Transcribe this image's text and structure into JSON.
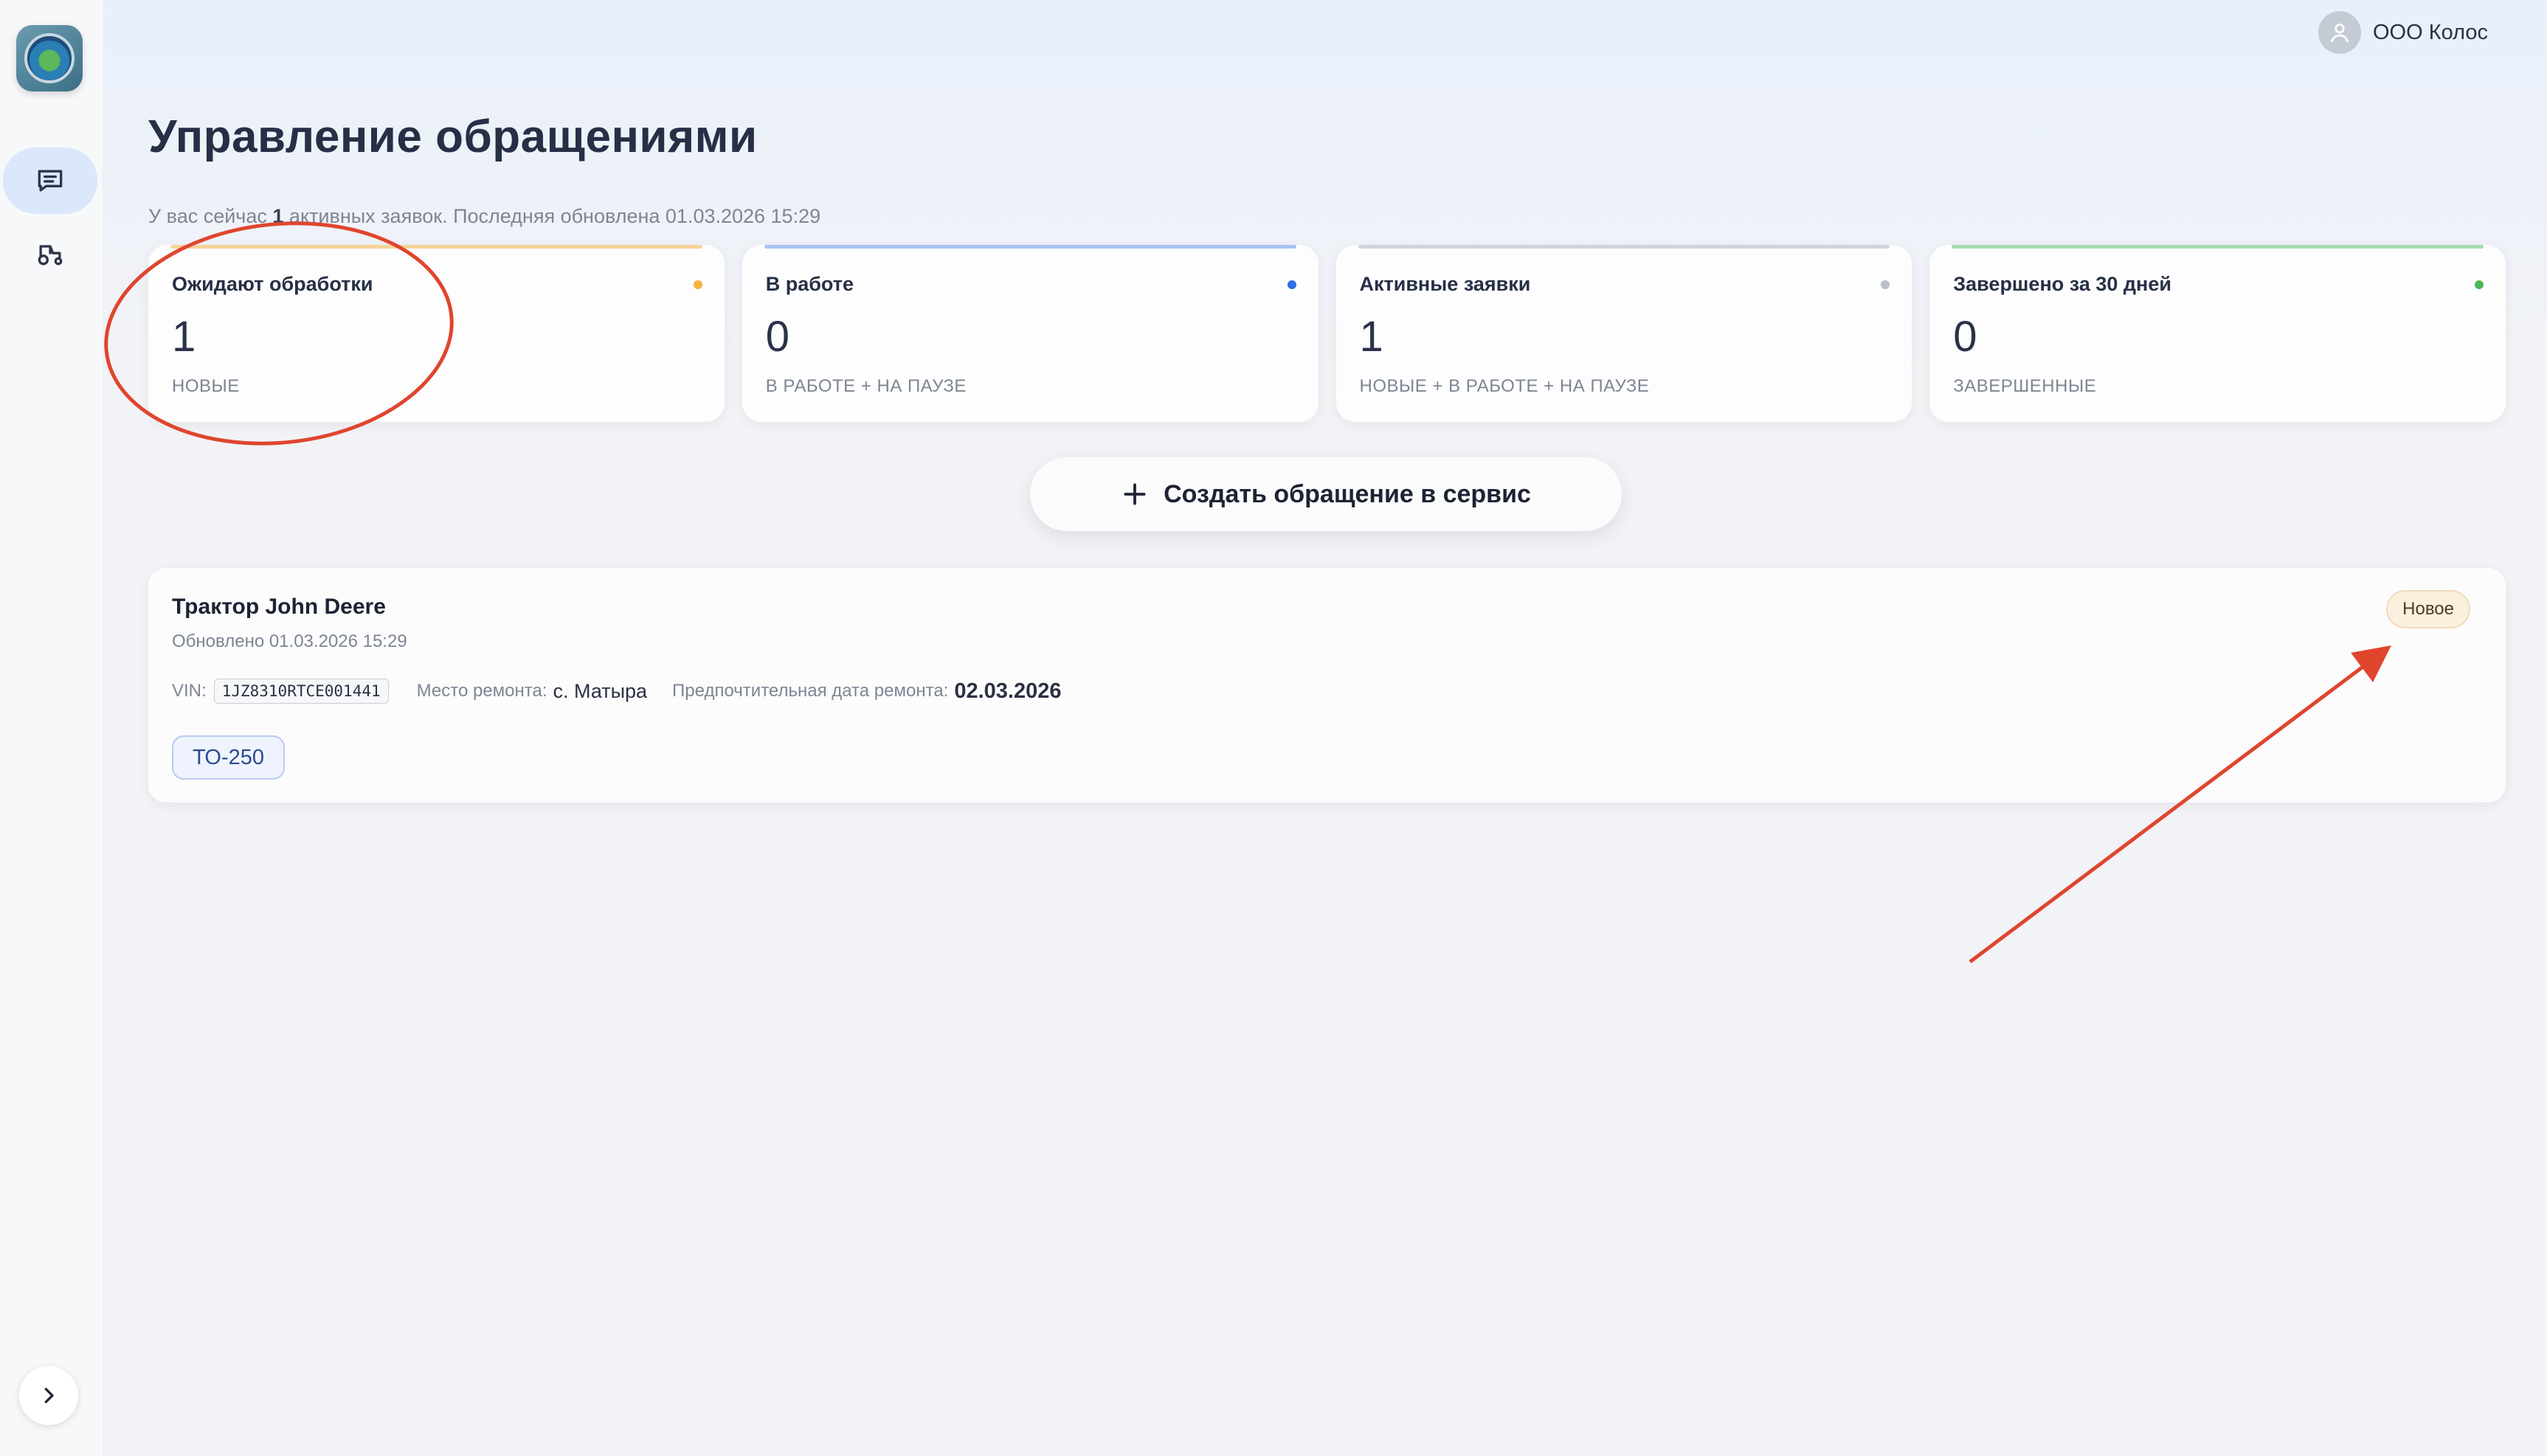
{
  "user": {
    "name": "ООО Колос",
    "icon": "user-icon"
  },
  "sidebar": {
    "items": [
      {
        "name": "requests",
        "icon": "message-list-icon",
        "active": true
      },
      {
        "name": "machinery",
        "icon": "tractor-icon",
        "active": false
      }
    ],
    "expand_icon": "chevron-right-icon"
  },
  "page": {
    "title": "Управление обращениями",
    "subtitle_prefix": "У вас сейчас ",
    "subtitle_count": "1",
    "subtitle_suffix": " активных заявок. Последняя обновлена 01.03.2026 15:29"
  },
  "stats": [
    {
      "label": "Ожидают обработки",
      "value": "1",
      "caption": "НОВЫЕ",
      "color": "#f2b33d",
      "bar": "#f6d49a"
    },
    {
      "label": "В работе",
      "value": "0",
      "caption": "В РАБОТЕ + НА ПАУЗЕ",
      "color": "#2f6fe4",
      "bar": "#a9c4f2"
    },
    {
      "label": "Активные заявки",
      "value": "1",
      "caption": "НОВЫЕ + В РАБОТЕ + НА ПАУЗЕ",
      "color": "#b9bec7",
      "bar": "#cfd3dc"
    },
    {
      "label": "Завершено за 30 дней",
      "value": "0",
      "caption": "ЗАВЕРШЕННЫЕ",
      "color": "#4cb85a",
      "bar": "#a7dcae"
    }
  ],
  "create_button": {
    "label": "Создать обращение в сервис",
    "icon": "plus-icon"
  },
  "request": {
    "title": "Трактор John Deere",
    "updated": "Обновлено 01.03.2026 15:29",
    "status": "Новое",
    "vin_label": "VIN:",
    "vin": "1JZ8310RTCE001441",
    "place_label": "Место ремонта:",
    "place": "с. Матыра",
    "date_label": "Предпочтительная дата ремонта:",
    "date": "02.03.2026",
    "tag": "ТО-250"
  },
  "annotations": {
    "color": "#e0452e"
  }
}
